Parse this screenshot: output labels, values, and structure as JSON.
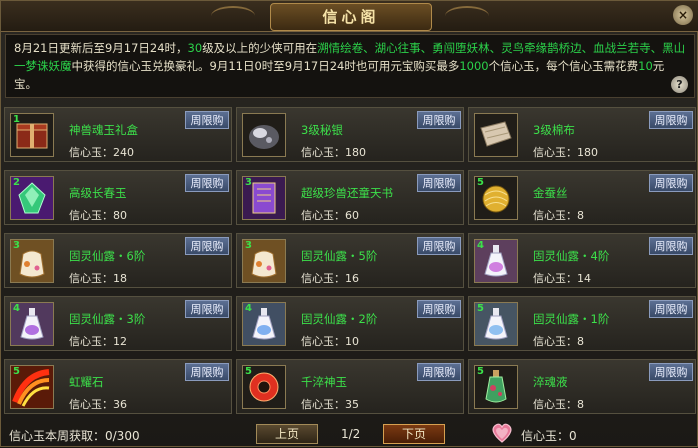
{
  "window": {
    "title": "信心阁",
    "close_label": "×"
  },
  "notice": {
    "parts": [
      {
        "t": "8月21日更新后至9月17日24时，",
        "c": "c"
      },
      {
        "t": "30",
        "c": "g"
      },
      {
        "t": "级及以上的少侠可用在",
        "c": "c"
      },
      {
        "t": "溯情绘卷、湖心往事、勇闯堕妖林、灵鸟牵缘鹊桥边、血战兰若寺、黑山一梦诛妖魔",
        "c": "g"
      },
      {
        "t": "中获得的信心玉兑换豪礼。9月11日0时至9月17日24时也可用元宝购买最多",
        "c": "c"
      },
      {
        "t": "1000",
        "c": "g"
      },
      {
        "t": "个信心玉，每个信心玉需花费",
        "c": "c"
      },
      {
        "t": "10",
        "c": "g"
      },
      {
        "t": "元宝。",
        "c": "c"
      }
    ],
    "help_label": "?"
  },
  "tag_label": "周限购",
  "price_prefix": "信心玉：",
  "items": [
    {
      "level": "1",
      "name": "神兽魂玉礼盒",
      "price": "240",
      "icon": "gift-box-icon",
      "color": "#8b2a18"
    },
    {
      "level": "",
      "name": "3级秘银",
      "price": "180",
      "icon": "silver-ore-icon",
      "color": "#8a8a90"
    },
    {
      "level": "",
      "name": "3级棉布",
      "price": "180",
      "icon": "cotton-cloth-icon",
      "color": "#c8b8a0"
    },
    {
      "level": "2",
      "name": "高级长春玉",
      "price": "80",
      "icon": "jade-gem-icon",
      "color": "#35c87a"
    },
    {
      "level": "3",
      "name": "超级珍兽还童天书",
      "price": "60",
      "icon": "scroll-book-icon",
      "color": "#8a4ad0"
    },
    {
      "level": "5",
      "name": "金蚕丝",
      "price": "8",
      "icon": "gold-silk-icon",
      "color": "#e0b030"
    },
    {
      "level": "3",
      "name": "固灵仙露・6阶",
      "price": "18",
      "icon": "elixir-pouch-icon",
      "color": "#f0c060"
    },
    {
      "level": "3",
      "name": "固灵仙露・5阶",
      "price": "16",
      "icon": "elixir-pouch-icon",
      "color": "#f0b050"
    },
    {
      "level": "4",
      "name": "固灵仙露・4阶",
      "price": "14",
      "icon": "elixir-bottle-icon",
      "color": "#d080e0"
    },
    {
      "level": "4",
      "name": "固灵仙露・3阶",
      "price": "12",
      "icon": "elixir-bottle-icon",
      "color": "#b070e0"
    },
    {
      "level": "4",
      "name": "固灵仙露・2阶",
      "price": "10",
      "icon": "elixir-bottle-icon",
      "color": "#80b0f0"
    },
    {
      "level": "5",
      "name": "固灵仙露・1阶",
      "price": "8",
      "icon": "elixir-bottle-icon",
      "color": "#90c0f0"
    },
    {
      "level": "5",
      "name": "虹耀石",
      "price": "36",
      "icon": "rainbow-stone-icon",
      "color": "#e05020"
    },
    {
      "level": "5",
      "name": "千淬神玉",
      "price": "35",
      "icon": "red-jade-ring-icon",
      "color": "#e03020"
    },
    {
      "level": "5",
      "name": "淬魂液",
      "price": "8",
      "icon": "soul-potion-icon",
      "color": "#40a060"
    }
  ],
  "footer": {
    "weekly_label": "信心玉本周获取：0/300",
    "prev_label": "上页",
    "page_label": "1/2",
    "next_label": "下页",
    "balance_label": "信心玉：0"
  }
}
